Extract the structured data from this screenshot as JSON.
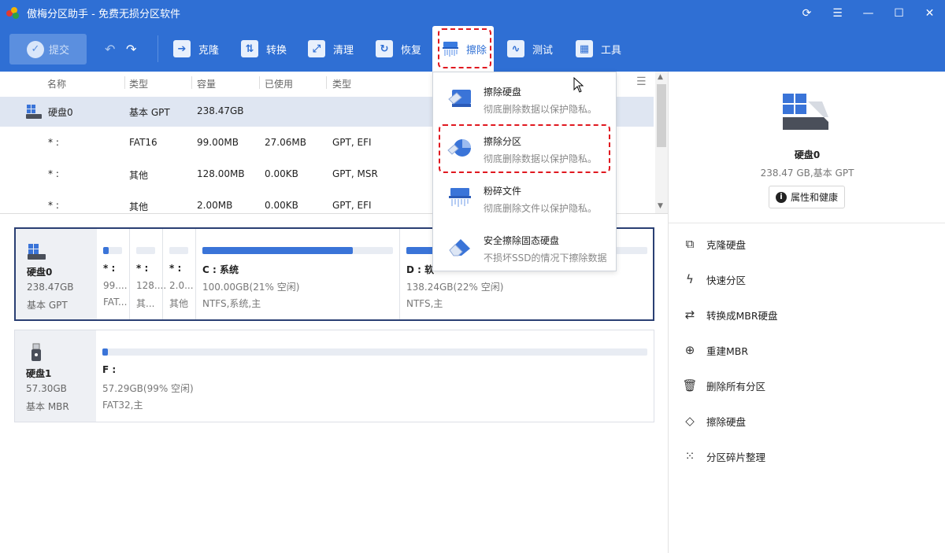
{
  "window": {
    "title": "傲梅分区助手 - 免费无损分区软件"
  },
  "toolbar": {
    "submit": "提交",
    "items": [
      "克隆",
      "转换",
      "清理",
      "恢复",
      "擦除",
      "测试",
      "工具"
    ]
  },
  "table": {
    "headers": [
      "名称",
      "类型",
      "容量",
      "已使用",
      "类型"
    ],
    "rows": [
      {
        "name": "硬盘0",
        "type": "基本 GPT",
        "capacity": "238.47GB",
        "used": "",
        "fs": ""
      },
      {
        "name": "* :",
        "type": "FAT16",
        "capacity": "99.00MB",
        "used": "27.06MB",
        "fs": "GPT, EFI"
      },
      {
        "name": "* :",
        "type": "其他",
        "capacity": "128.00MB",
        "used": "0.00KB",
        "fs": "GPT, MSR"
      },
      {
        "name": "* :",
        "type": "其他",
        "capacity": "2.00MB",
        "used": "0.00KB",
        "fs": "GPT, EFI"
      }
    ]
  },
  "disk0": {
    "name": "硬盘0",
    "size": "238.47GB",
    "type": "基本 GPT",
    "partitions": [
      {
        "name": "* :",
        "cap": "99....",
        "fs": "FAT...",
        "used_pct": 30
      },
      {
        "name": "* :",
        "cap": "128....",
        "fs": "其...",
        "used_pct": 0
      },
      {
        "name": "* :",
        "cap": "2.0...",
        "fs": "其他",
        "used_pct": 0
      },
      {
        "name": "C : 系统",
        "cap": "100.00GB(21% 空闲)",
        "fs": "NTFS,系统,主",
        "used_pct": 79
      },
      {
        "name": "D : 软",
        "cap": "138.24GB(22% 空闲)",
        "fs": "NTFS,主",
        "used_pct": 78
      }
    ]
  },
  "disk1": {
    "name": "硬盘1",
    "size": "57.30GB",
    "type": "基本 MBR",
    "partitions": [
      {
        "name": "F :",
        "cap": "57.29GB(99% 空闲)",
        "fs": "FAT32,主",
        "used_pct": 1
      }
    ]
  },
  "right_panel": {
    "disk_name": "硬盘0",
    "disk_sub": "238.47 GB,基本 GPT",
    "props_button": "属性和健康",
    "ops": [
      "克隆硬盘",
      "快速分区",
      "转换成MBR硬盘",
      "重建MBR",
      "删除所有分区",
      "擦除硬盘",
      "分区碎片整理"
    ]
  },
  "dropdown": {
    "items": [
      {
        "title": "擦除硬盘",
        "desc": "彻底删除数据以保护隐私。"
      },
      {
        "title": "擦除分区",
        "desc": "彻底删除数据以保护隐私。"
      },
      {
        "title": "粉碎文件",
        "desc": "彻底删除文件以保护隐私。"
      },
      {
        "title": "安全擦除固态硬盘",
        "desc": "不损坏SSD的情况下擦除数据"
      }
    ]
  },
  "colors": {
    "accent": "#2f6fd4",
    "highlight": "#e0181f",
    "selected_row": "#dfe6f2"
  }
}
